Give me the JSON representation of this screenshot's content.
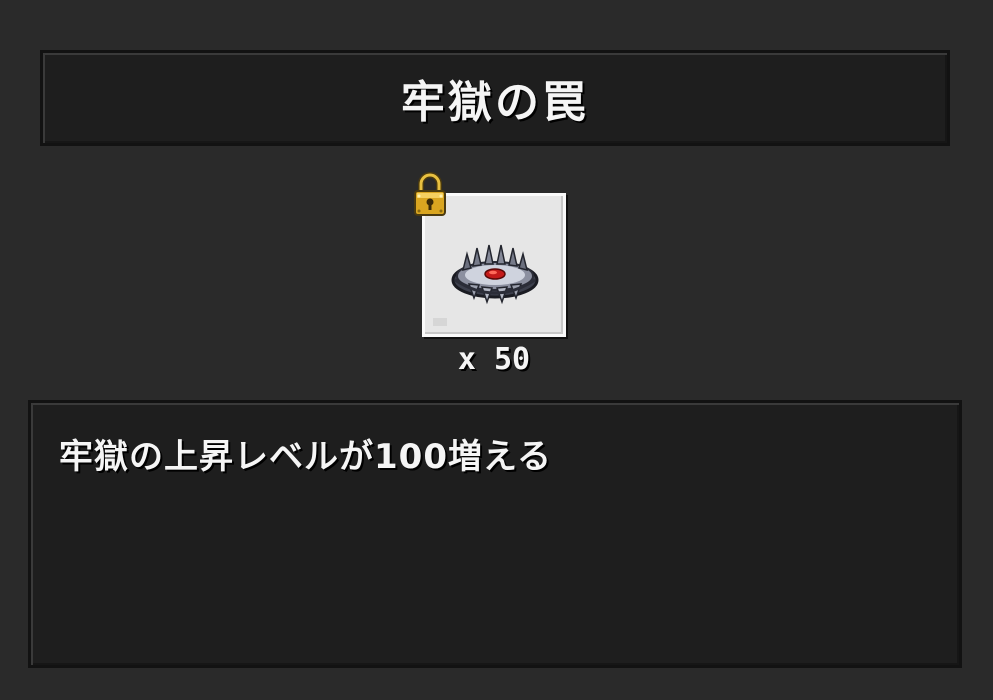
{
  "item": {
    "name": "牢獄の罠",
    "quantity_text": "x 50",
    "description": "牢獄の上昇レベルが100増える",
    "icon": "bear-trap-icon",
    "locked": true,
    "lock_icon": "padlock-icon"
  },
  "colors": {
    "background": "#2a2a2a",
    "panel": "#1e1e1e",
    "slot": "#e6e6e6",
    "text": "#f5f5f5"
  }
}
